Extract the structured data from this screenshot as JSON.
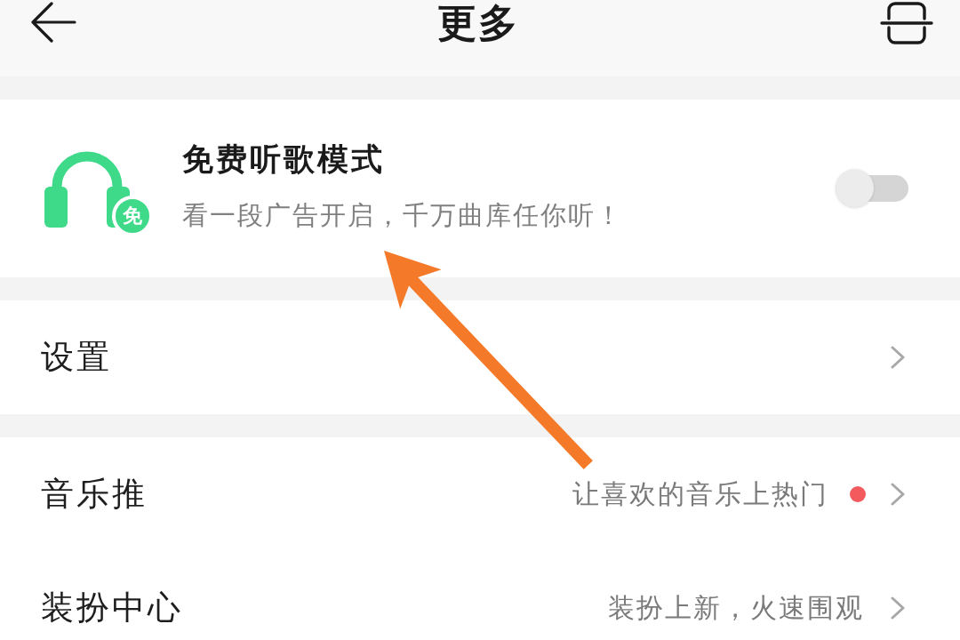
{
  "header": {
    "title": "更多"
  },
  "free_mode": {
    "title": "免费听歌模式",
    "subtitle": "看一段广告开启，千万曲库任你听！",
    "badge": "免",
    "on": false
  },
  "groups": [
    {
      "items": [
        {
          "label": "设置",
          "dot": false
        }
      ]
    },
    {
      "items": [
        {
          "label": "音乐推",
          "value": "让喜欢的音乐上热门",
          "dot": true
        },
        {
          "label": "装扮中心",
          "value": "装扮上新，火速围观",
          "dot": false
        }
      ]
    }
  ]
}
